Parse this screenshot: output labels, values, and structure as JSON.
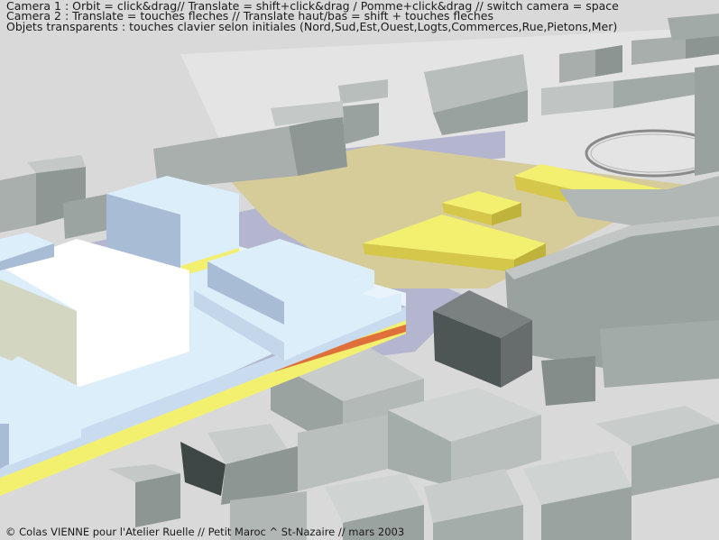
{
  "help": {
    "line1": "Camera 1 : Orbit = click&drag// Translate = shift+click&drag / Pomme+click&drag  // switch camera = space",
    "line2": "Camera 2 : Translate = touches fleches // Translate haut/bas = shift + touches fleches",
    "line3": "Objets transparents : touches clavier selon initiales (Nord,Sud,Est,Ouest,Logts,Commerces,Rue,Pietons,Mer)"
  },
  "footer": {
    "credits": "© Colas VIENNE pour l'Atelier Ruelle // Petit Maroc ^ St-Nazaire // mars 2003"
  },
  "colors": {
    "background": "#dadada",
    "block_white": "#ffffff",
    "block_light_blue": "#dceefa",
    "block_blue_side": "#a9bcd6",
    "plaza_tan": "#d6cc9a",
    "highlight_yellow": "#f2f06e",
    "street_purple": "#b4b6cf",
    "accent_orange": "#e0703a",
    "grey_building": "#9aa3a0",
    "dark_grey_building": "#5b6262"
  }
}
